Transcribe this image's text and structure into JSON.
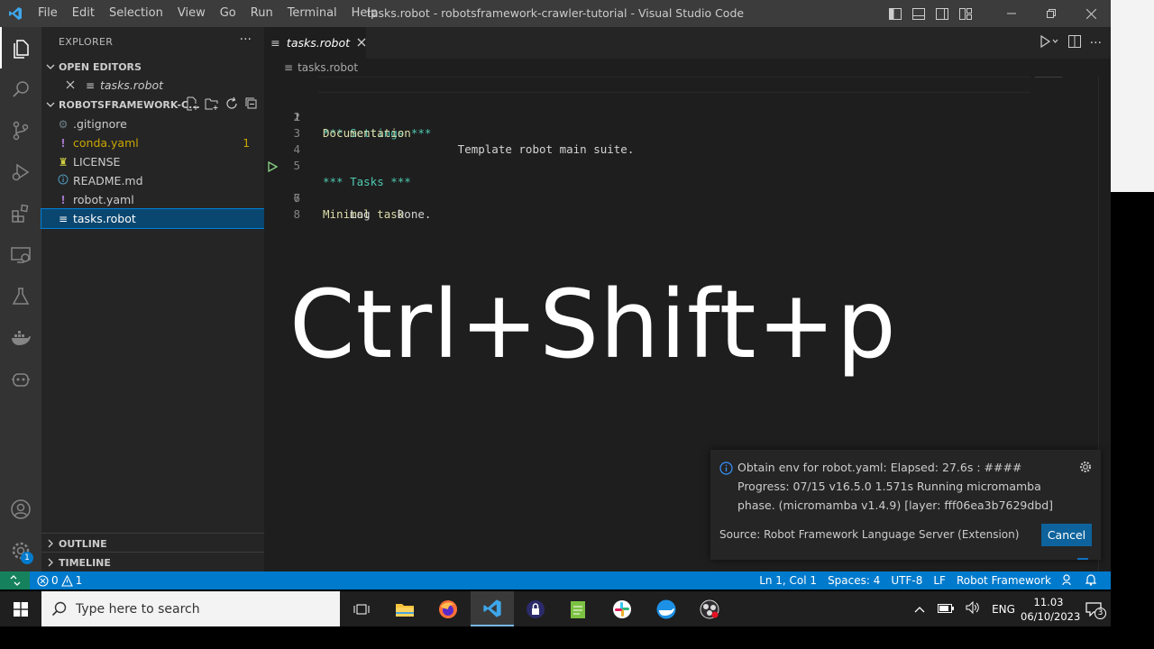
{
  "window": {
    "title": "tasks.robot - robotsframework-crawler-tutorial - Visual Studio Code",
    "menu": [
      "File",
      "Edit",
      "Selection",
      "View",
      "Go",
      "Run",
      "Terminal",
      "Help"
    ]
  },
  "sidebar": {
    "header": "EXPLORER",
    "open_editors_label": "OPEN EDITORS",
    "open_editor_file": "tasks.robot",
    "folder_label": "ROBOTSFRAMEWORK-C...",
    "files": [
      {
        "name": ".gitignore",
        "icon": "gear-file-icon"
      },
      {
        "name": "conda.yaml",
        "icon": "exclamation-file-icon",
        "badge": "1"
      },
      {
        "name": "LICENSE",
        "icon": "license-icon"
      },
      {
        "name": "README.md",
        "icon": "info-icon"
      },
      {
        "name": "robot.yaml",
        "icon": "exclamation-file-icon"
      },
      {
        "name": "tasks.robot",
        "icon": "lines-file-icon"
      }
    ],
    "outline_label": "OUTLINE",
    "timeline_label": "TIMELINE"
  },
  "editor": {
    "tab_label": "tasks.robot",
    "breadcrumb": "tasks.robot",
    "lines": [
      {
        "n": "1",
        "a": "*** Settings ***",
        "b": ""
      },
      {
        "n": "2",
        "a": "Documentation",
        "b": "       Template robot main suite."
      },
      {
        "n": "3",
        "a": "",
        "b": ""
      },
      {
        "n": "4",
        "a": "",
        "b": ""
      },
      {
        "n": "5",
        "a": "*** Tasks ***",
        "b": ""
      },
      {
        "n": "6",
        "a": "Minimal task",
        "b": ""
      },
      {
        "n": "7",
        "a": "",
        "b": "    Log    Done."
      },
      {
        "n": "8",
        "a": "",
        "b": ""
      }
    ],
    "overlay_text": "Ctrl+Shift+p"
  },
  "notification": {
    "message": "Obtain env for robot.yaml: Elapsed: 27.6s : #### Progress: 07/15 v16.5.0 1.571s Running micromamba phase. (micromamba v1.4.9) [layer: fff06ea3b7629dbd]",
    "source": "Source: Robot Framework Language Server (Extension)",
    "cancel_label": "Cancel"
  },
  "statusbar": {
    "errors": "0",
    "warnings": "1",
    "position": "Ln 1, Col 1",
    "spaces": "Spaces: 4",
    "encoding": "UTF-8",
    "eol": "LF",
    "language": "Robot Framework"
  },
  "taskbar": {
    "search_placeholder": "Type here to search",
    "language": "ENG",
    "time": "11.03",
    "date": "06/10/2023",
    "notification_count": "3"
  },
  "activity_badge": "1"
}
